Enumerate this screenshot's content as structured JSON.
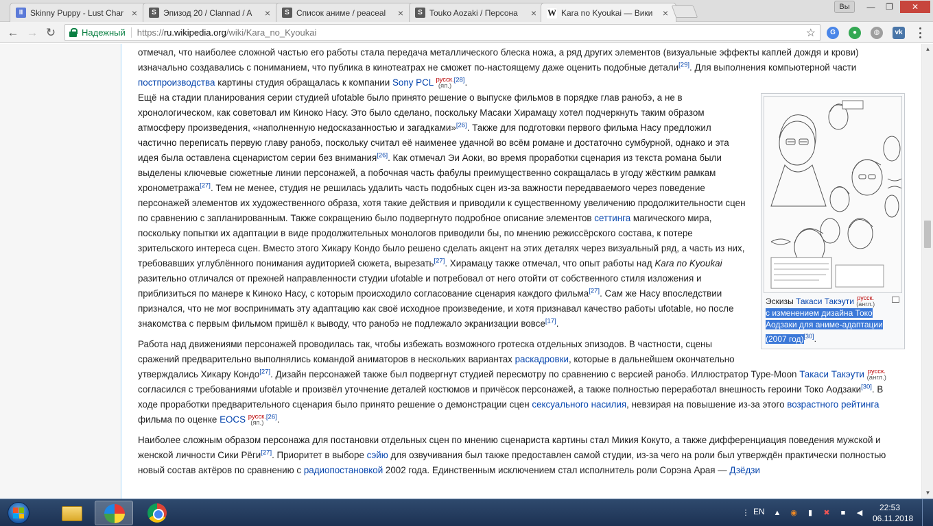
{
  "tabs": [
    {
      "title": "Skinny Puppy - Lust Char",
      "favicon": "pause-icon"
    },
    {
      "title": "Эпизод 20 / Clannad / A",
      "favicon": "s-icon"
    },
    {
      "title": "Список аниме / peaceal",
      "favicon": "s-icon"
    },
    {
      "title": "Touko Aozaki / Персона",
      "favicon": "s-icon"
    },
    {
      "title": "Kara no Kyoukai — Вики",
      "favicon": "wikipedia-icon",
      "active": true
    }
  ],
  "window": {
    "user_chip": "Вы",
    "minimize": "—",
    "maximize": "❐",
    "close": "✕"
  },
  "toolbar": {
    "back": "←",
    "forward": "→",
    "reload": "↻",
    "secure_label": "Надежный",
    "url_scheme": "https://",
    "url_host": "ru.wikipedia.org",
    "url_path": "/wiki/Kara_no_Kyoukai",
    "star": "☆"
  },
  "extensions": [
    {
      "name": "translate-icon",
      "glyph": "G",
      "color": "#4a86e8"
    },
    {
      "name": "adblock-icon",
      "glyph": "●",
      "color": "#34a853"
    },
    {
      "name": "globe-icon",
      "glyph": "◍",
      "color": "#9e9e9e"
    },
    {
      "name": "vk-icon",
      "glyph": "vk",
      "color": "#4a76a8"
    }
  ],
  "article": {
    "p0_a": "отмечал, что наиболее сложной частью его работы стала передача металлического блеска ножа, а ряд других элементов (визуальные эффекты каплей дождя и крови) изначально создавались с пониманием, что публика в кинотеатрах не сможет по-настоящему даже оценить подобные детали",
    "p0_ref1": "[29]",
    "p0_b": ". Для выполнения компьютерной части ",
    "p0_link1": "постпроизводства",
    "p0_c": " картины студия обращалась к компании ",
    "p0_link2": "Sony PCL",
    "p0_lang_top": "русск.",
    "p0_lang_bottom": "(яп.)",
    "p0_ref2": "[28]",
    "p0_end": ".",
    "p1_a": "Ещё на стадии планирования серии студией ufotable было принято решение о выпуске фильмов в порядке глав ранобэ, а не в хронологическом, как советовал им Киноко Насу. Это было сделано, поскольку Масаки Хирамацу хотел подчеркнуть таким образом атмосферу произведения, «наполненную недосказанностью и загадками»",
    "p1_ref1": "[26]",
    "p1_b": ". Также для подготовки первого фильма Насу предложил частично переписать первую главу ранобэ, поскольку считал её наименее удачной во всём романе и достаточно сумбурной, однако и эта идея была оставлена сценаристом серии без внимания",
    "p1_ref2": "[26]",
    "p1_c": ". Как отмечал Эи Аоки, во время проработки сценария из текста романа были выделены ключевые сюжетные линии персонажей, а побочная часть фабулы преимущественно сокращалась в угоду жёстким рамкам хронометража",
    "p1_ref3": "[27]",
    "p1_d": ". Тем не менее, студия не решилась удалить часть подобных сцен из-за важности передаваемого через поведение персонажей элементов их художественного образа, хотя такие действия и приводили к существенному увеличению продолжительности сцен по сравнению с запланированным. Также сокращению было подвергнуто подробное описание элементов ",
    "p1_link1": "сеттинга",
    "p1_e": " магического мира, поскольку попытки их адаптации в виде продолжительных монологов приводили бы, по мнению режиссёрского состава, к потере зрительского интереса сцен. Вместо этого Хикару Кондо было решено сделать акцент на этих деталях через визуальный ряд, а часть из них, требовавших углублённого понимания аудиторией сюжета, вырезать",
    "p1_ref4": "[27]",
    "p1_f": ". Хирамацу также отмечал, что опыт работы над ",
    "p1_italic": "Kara no Kyoukai",
    "p1_g": " разительно отличался от прежней направленности студии ufotable и потребовал от него отойти от собственного стиля изложения и приблизиться по манере к Киноко Насу, с которым происходило согласование сценария каждого фильма",
    "p1_ref5": "[27]",
    "p1_h": ". Сам же Насу впоследствии признался, что не мог воспринимать эту адаптацию как своё исходное произведение, и хотя признавал качество работы ufotable, но после знакомства с первым фильмом пришёл к выводу, что ранобэ не подлежало экранизации вовсе",
    "p1_ref6": "[17]",
    "p1_end": ".",
    "p2_a": "Работа над движениями персонажей проводилась так, чтобы избежать возможного гротеска отдельных эпизодов. В частности, сцены сражений предварительно выполнялись командой аниматоров в нескольких вариантах ",
    "p2_link1": "раскадровки",
    "p2_b": ", которые в дальнейшем окончательно утверждались Хикару Кондо",
    "p2_ref1": "[27]",
    "p2_c": ". Дизайн персонажей также был подвергнут студией пересмотру по сравнению с версией ранобэ. Иллюстратор Type-Moon ",
    "p2_link2": "Такаси Такэути",
    "p2_lang_top": "русск.",
    "p2_lang_bottom": "(англ.)",
    "p2_d": " согласился с требованиями ufotable и произвёл уточнение деталей костюмов и причёсок персонажей, а также полностью переработал внешность героини Токо Аодзаки",
    "p2_ref2": "[30]",
    "p2_e": ". В ходе проработки предварительного сценария было принято решение о демонстрации сцен ",
    "p2_link3": "сексуального насилия",
    "p2_f": ", невзирая на повышение из-за этого ",
    "p2_link4": "возрастного рейтинга",
    "p2_g": " фильма по оценке ",
    "p2_link5": "EOCS",
    "p2_lang2_top": "русск.",
    "p2_lang2_bottom": "(яп.)",
    "p2_ref3": "[26]",
    "p2_end": ".",
    "p3_a": "Наиболее сложным образом персонажа для постановки отдельных сцен по мнению сценариста картины стал Микия Кокуто, а также дифференциация поведения мужской и женской личности Сики Рёги",
    "p3_ref1": "[27]",
    "p3_b": ". Приоритет в выборе ",
    "p3_link1": "сэйю",
    "p3_c": " для озвучивания был также предоставлен самой студии, из-за чего на роли был утверждён практически полностью новый состав актёров по сравнению с ",
    "p3_link2": "радиопостановкой",
    "p3_d": " 2002 года. Единственным исключением стал исполнитель роли Сорэна Арая — ",
    "p3_link3": "Дзёдзи"
  },
  "thumb": {
    "cap_a": "Эскизы ",
    "cap_link": "Такаси Такэути",
    "cap_lang_top": "русск.",
    "cap_lang_bottom": "(англ.)",
    "cap_selected": "с изменением дизайна Токо Аодзаки для аниме-адаптации (2007 год)",
    "cap_ref": "[30]",
    "cap_end": "."
  },
  "taskbar": {
    "lang": "EN",
    "time": "22:53",
    "date": "06.11.2018"
  }
}
